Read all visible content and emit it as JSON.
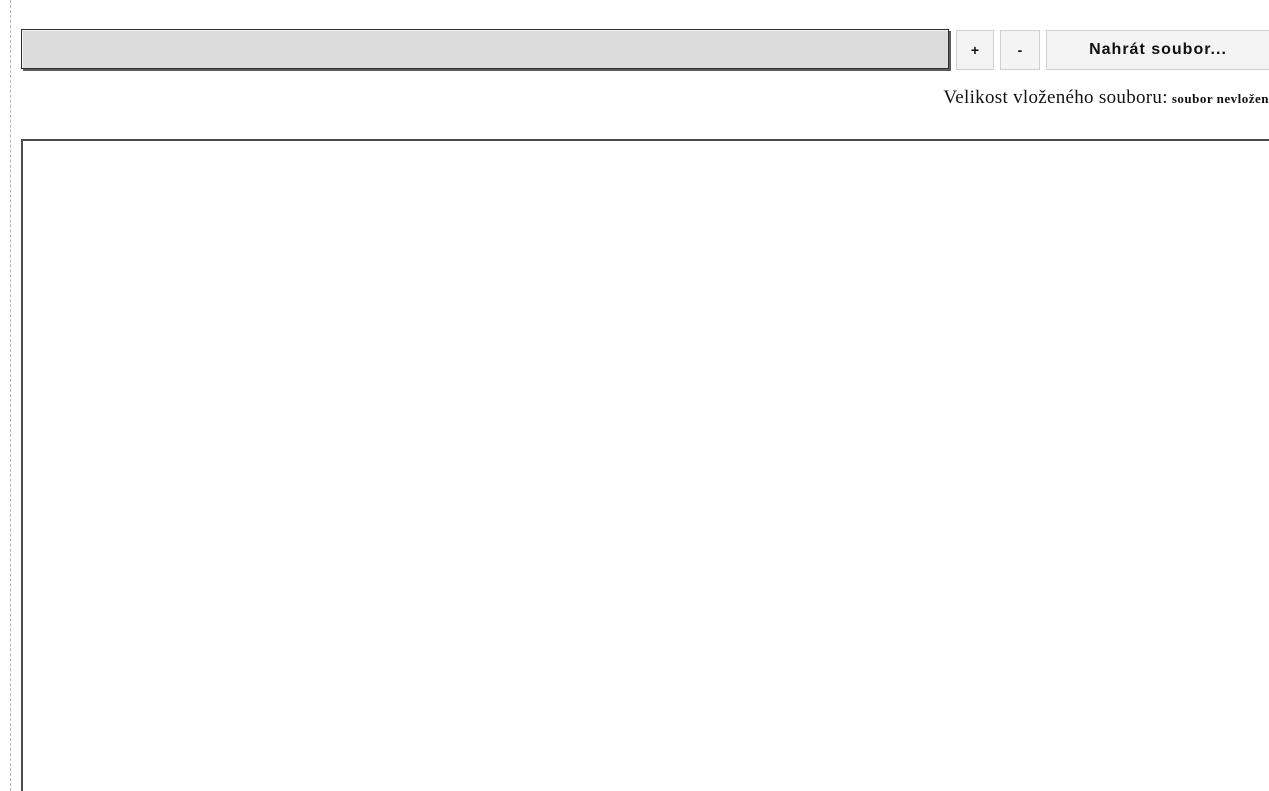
{
  "file_input": {
    "value": ""
  },
  "toolbar": {
    "add_label": "+",
    "remove_label": "-",
    "upload_label": "Nahrát soubor..."
  },
  "file_size": {
    "label": "Velikost vloženého souboru:",
    "value": "soubor nevložen"
  },
  "preview": {
    "content": ""
  }
}
